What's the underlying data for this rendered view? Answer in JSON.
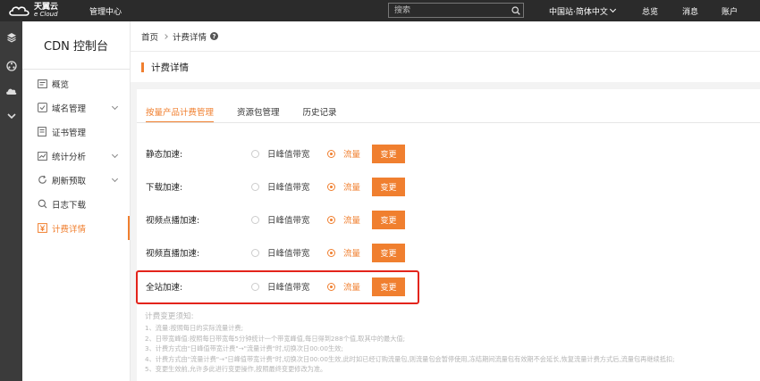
{
  "topbar": {
    "logo_cn": "天翼云",
    "logo_en": "e Cloud",
    "mgmt_center": "管理中心",
    "search_placeholder": "搜索",
    "region": "中国站·简体中文",
    "overview": "总览",
    "messages": "消息",
    "account": "账户"
  },
  "rail": {
    "icons": [
      "layers-icon",
      "network-icon",
      "cloud-icon",
      "chevron-down-icon"
    ]
  },
  "sidebar": {
    "title": "CDN 控制台",
    "items": [
      {
        "label": "概览"
      },
      {
        "label": "域名管理"
      },
      {
        "label": "证书管理"
      },
      {
        "label": "统计分析"
      },
      {
        "label": "刷新预取"
      },
      {
        "label": "日志下载"
      },
      {
        "label": "计费详情"
      }
    ]
  },
  "breadcrumb": {
    "home": "首页",
    "current": "计费详情",
    "help": "?"
  },
  "section": {
    "title": "计费详情"
  },
  "tabs": [
    {
      "label": "按量产品计费管理"
    },
    {
      "label": "资源包管理"
    },
    {
      "label": "历史记录"
    }
  ],
  "billing_rows": [
    {
      "label": "静态加速:",
      "peak": "日峰值带宽",
      "flow": "流量",
      "button": "变更"
    },
    {
      "label": "下载加速:",
      "peak": "日峰值带宽",
      "flow": "流量",
      "button": "变更"
    },
    {
      "label": "视频点播加速:",
      "peak": "日峰值带宽",
      "flow": "流量",
      "button": "变更"
    },
    {
      "label": "视频直播加速:",
      "peak": "日峰值带宽",
      "flow": "流量",
      "button": "变更"
    },
    {
      "label": "全站加速:",
      "peak": "日峰值带宽",
      "flow": "流量",
      "button": "变更"
    }
  ],
  "colors": {
    "accent": "#f07f2f",
    "highlight": "#e3241b",
    "topbar": "#2b2b2b"
  },
  "notes": {
    "title": "计费变更须知:",
    "lines": [
      "1、流量:按照每日的实际流量计费;",
      "2、日带宽峰值:按照每日带宽每5分钟统计一个带宽峰值,每日得到288个值,取其中的最大值;",
      "3、计费方式由\"日峰值带宽计费\"→\"流量计费\"时,切换次日00:00生效;",
      "4、计费方式由\"流量计费\"→\"日峰值带宽计费\"时,切换次日00:00生效,此时如已经订购流量包,则流量包会暂停使用,冻结期间流量包有效期不会延长,恢复流量计费方式后,流量包再继续抵扣;",
      "5、变更生效前,允许多此进行变更操作,按照最终变更修改为准。"
    ]
  }
}
